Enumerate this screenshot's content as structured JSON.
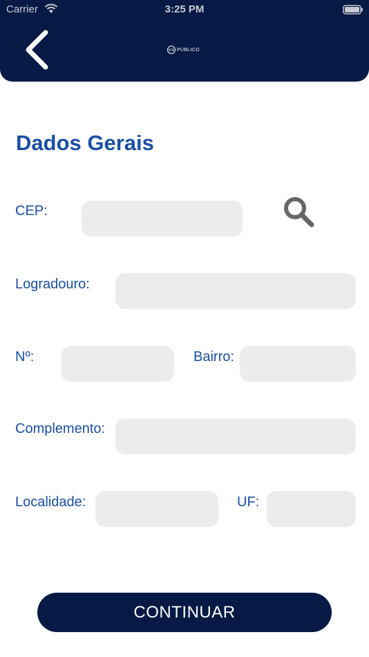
{
  "status_bar": {
    "carrier": "Carrier",
    "time": "3:25 PM"
  },
  "header": {
    "back_icon": "chevron-left-icon",
    "logo_badge": "VIA",
    "logo_text": "PÚBLICO"
  },
  "page": {
    "title": "Dados Gerais"
  },
  "form": {
    "cep": {
      "label": "CEP:",
      "value": ""
    },
    "logradouro": {
      "label": "Logradouro:",
      "value": ""
    },
    "numero": {
      "label": "Nº:",
      "value": ""
    },
    "bairro": {
      "label": "Bairro:",
      "value": ""
    },
    "complemento": {
      "label": "Complemento:",
      "value": ""
    },
    "localidade": {
      "label": "Localidade:",
      "value": ""
    },
    "uf": {
      "label": "UF:",
      "value": ""
    },
    "search_icon": "search-icon"
  },
  "actions": {
    "continue_label": "CONTINUAR"
  },
  "colors": {
    "header_bg": "#071a45",
    "label": "#1a4fa3",
    "input_bg": "#ececec",
    "search_icon": "#666666"
  }
}
